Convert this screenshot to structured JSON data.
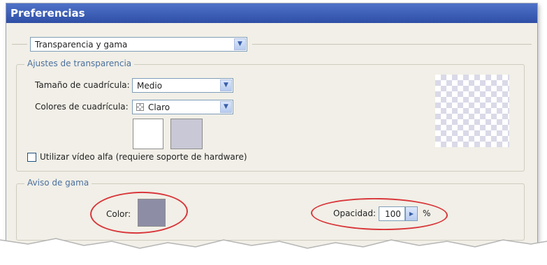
{
  "window": {
    "title": "Preferencias"
  },
  "category_select": {
    "value": "Transparencia y gama"
  },
  "transparency": {
    "title": "Ajustes de transparencia",
    "grid_size_label": "Tamaño de cuadrícula:",
    "grid_size_value": "Medio",
    "grid_colors_label": "Colores de cuadrícula:",
    "grid_colors_value": "Claro",
    "swatch1_color": "#ffffff",
    "swatch2_color": "#c8c8d6",
    "alpha_checkbox_label": "Utilizar vídeo alfa (requiere soporte de hardware)",
    "alpha_checkbox_checked": false
  },
  "gamut": {
    "title": "Aviso de gama",
    "color_label": "Color:",
    "color_value": "#8d8da6",
    "opacity_label": "Opacidad:",
    "opacity_value": "100",
    "opacity_unit": "%"
  },
  "icons": [
    "chevron-down-icon",
    "checker-icon",
    "chevron-right-icon"
  ],
  "annotation_color": "#d9363a"
}
